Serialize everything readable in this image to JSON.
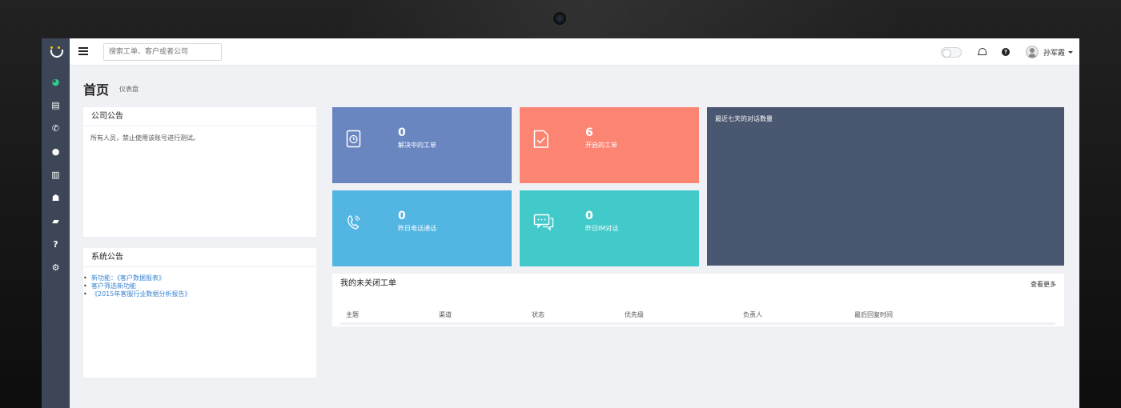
{
  "topbar": {
    "search_placeholder": "搜索工单、客户或者公司",
    "user_name": "孙军霞"
  },
  "sidebar": {
    "items": [
      {
        "name": "dashboard",
        "glyph": "◕"
      },
      {
        "name": "tickets",
        "glyph": "▤"
      },
      {
        "name": "phone",
        "glyph": "✆"
      },
      {
        "name": "chat",
        "glyph": "●"
      },
      {
        "name": "reports",
        "glyph": "▥"
      },
      {
        "name": "customers",
        "glyph": "☗"
      },
      {
        "name": "knowledge",
        "glyph": "▰"
      },
      {
        "name": "help",
        "glyph": "?"
      },
      {
        "name": "settings",
        "glyph": "⚙"
      }
    ]
  },
  "page": {
    "title": "首页",
    "subtitle": "仪表盘"
  },
  "company_notice": {
    "title": "公司公告",
    "body": "所有人员，禁止使用该账号进行测试。"
  },
  "system_notice": {
    "title": "系统公告",
    "items": [
      "新功能：《客户数据报表》",
      "客户筛选新功能",
      "《2015年客服行业数据分析报告》"
    ]
  },
  "tiles": [
    {
      "value": "0",
      "label": "解决中的工单",
      "color": "#6a86c1",
      "icon": "clock-doc-icon"
    },
    {
      "value": "6",
      "label": "开启的工单",
      "color": "#fc8473",
      "icon": "check-doc-icon"
    },
    {
      "value": "0",
      "label": "昨日电话通话",
      "color": "#52b5e2",
      "icon": "phone-icon"
    },
    {
      "value": "0",
      "label": "昨日IM对话",
      "color": "#41cac9",
      "icon": "chat-icon"
    }
  ],
  "chart": {
    "title": "最近七天的对话数量"
  },
  "tickets_table": {
    "title": "我的未关闭工单",
    "more_label": "查看更多",
    "columns": [
      "主题",
      "渠道",
      "状态",
      "优先级",
      "负责人",
      "最后回复时间"
    ]
  }
}
